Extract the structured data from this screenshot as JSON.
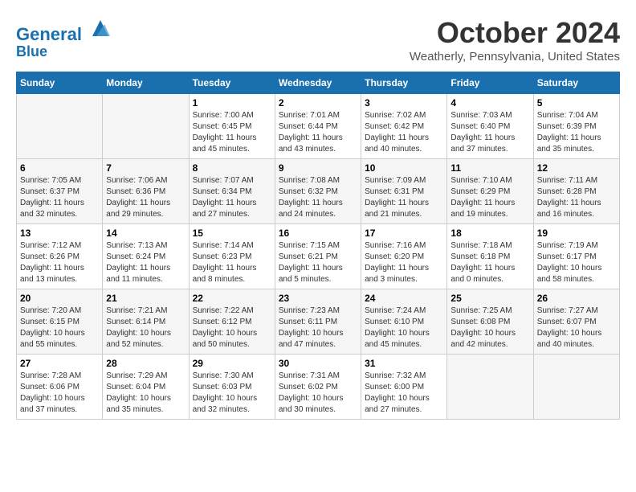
{
  "header": {
    "logo_line1": "General",
    "logo_line2": "Blue",
    "month_title": "October 2024",
    "location": "Weatherly, Pennsylvania, United States"
  },
  "weekdays": [
    "Sunday",
    "Monday",
    "Tuesday",
    "Wednesday",
    "Thursday",
    "Friday",
    "Saturday"
  ],
  "weeks": [
    [
      {
        "day": null
      },
      {
        "day": null
      },
      {
        "day": "1",
        "sunrise": "Sunrise: 7:00 AM",
        "sunset": "Sunset: 6:45 PM",
        "daylight": "Daylight: 11 hours and 45 minutes."
      },
      {
        "day": "2",
        "sunrise": "Sunrise: 7:01 AM",
        "sunset": "Sunset: 6:44 PM",
        "daylight": "Daylight: 11 hours and 43 minutes."
      },
      {
        "day": "3",
        "sunrise": "Sunrise: 7:02 AM",
        "sunset": "Sunset: 6:42 PM",
        "daylight": "Daylight: 11 hours and 40 minutes."
      },
      {
        "day": "4",
        "sunrise": "Sunrise: 7:03 AM",
        "sunset": "Sunset: 6:40 PM",
        "daylight": "Daylight: 11 hours and 37 minutes."
      },
      {
        "day": "5",
        "sunrise": "Sunrise: 7:04 AM",
        "sunset": "Sunset: 6:39 PM",
        "daylight": "Daylight: 11 hours and 35 minutes."
      }
    ],
    [
      {
        "day": "6",
        "sunrise": "Sunrise: 7:05 AM",
        "sunset": "Sunset: 6:37 PM",
        "daylight": "Daylight: 11 hours and 32 minutes."
      },
      {
        "day": "7",
        "sunrise": "Sunrise: 7:06 AM",
        "sunset": "Sunset: 6:36 PM",
        "daylight": "Daylight: 11 hours and 29 minutes."
      },
      {
        "day": "8",
        "sunrise": "Sunrise: 7:07 AM",
        "sunset": "Sunset: 6:34 PM",
        "daylight": "Daylight: 11 hours and 27 minutes."
      },
      {
        "day": "9",
        "sunrise": "Sunrise: 7:08 AM",
        "sunset": "Sunset: 6:32 PM",
        "daylight": "Daylight: 11 hours and 24 minutes."
      },
      {
        "day": "10",
        "sunrise": "Sunrise: 7:09 AM",
        "sunset": "Sunset: 6:31 PM",
        "daylight": "Daylight: 11 hours and 21 minutes."
      },
      {
        "day": "11",
        "sunrise": "Sunrise: 7:10 AM",
        "sunset": "Sunset: 6:29 PM",
        "daylight": "Daylight: 11 hours and 19 minutes."
      },
      {
        "day": "12",
        "sunrise": "Sunrise: 7:11 AM",
        "sunset": "Sunset: 6:28 PM",
        "daylight": "Daylight: 11 hours and 16 minutes."
      }
    ],
    [
      {
        "day": "13",
        "sunrise": "Sunrise: 7:12 AM",
        "sunset": "Sunset: 6:26 PM",
        "daylight": "Daylight: 11 hours and 13 minutes."
      },
      {
        "day": "14",
        "sunrise": "Sunrise: 7:13 AM",
        "sunset": "Sunset: 6:24 PM",
        "daylight": "Daylight: 11 hours and 11 minutes."
      },
      {
        "day": "15",
        "sunrise": "Sunrise: 7:14 AM",
        "sunset": "Sunset: 6:23 PM",
        "daylight": "Daylight: 11 hours and 8 minutes."
      },
      {
        "day": "16",
        "sunrise": "Sunrise: 7:15 AM",
        "sunset": "Sunset: 6:21 PM",
        "daylight": "Daylight: 11 hours and 5 minutes."
      },
      {
        "day": "17",
        "sunrise": "Sunrise: 7:16 AM",
        "sunset": "Sunset: 6:20 PM",
        "daylight": "Daylight: 11 hours and 3 minutes."
      },
      {
        "day": "18",
        "sunrise": "Sunrise: 7:18 AM",
        "sunset": "Sunset: 6:18 PM",
        "daylight": "Daylight: 11 hours and 0 minutes."
      },
      {
        "day": "19",
        "sunrise": "Sunrise: 7:19 AM",
        "sunset": "Sunset: 6:17 PM",
        "daylight": "Daylight: 10 hours and 58 minutes."
      }
    ],
    [
      {
        "day": "20",
        "sunrise": "Sunrise: 7:20 AM",
        "sunset": "Sunset: 6:15 PM",
        "daylight": "Daylight: 10 hours and 55 minutes."
      },
      {
        "day": "21",
        "sunrise": "Sunrise: 7:21 AM",
        "sunset": "Sunset: 6:14 PM",
        "daylight": "Daylight: 10 hours and 52 minutes."
      },
      {
        "day": "22",
        "sunrise": "Sunrise: 7:22 AM",
        "sunset": "Sunset: 6:12 PM",
        "daylight": "Daylight: 10 hours and 50 minutes."
      },
      {
        "day": "23",
        "sunrise": "Sunrise: 7:23 AM",
        "sunset": "Sunset: 6:11 PM",
        "daylight": "Daylight: 10 hours and 47 minutes."
      },
      {
        "day": "24",
        "sunrise": "Sunrise: 7:24 AM",
        "sunset": "Sunset: 6:10 PM",
        "daylight": "Daylight: 10 hours and 45 minutes."
      },
      {
        "day": "25",
        "sunrise": "Sunrise: 7:25 AM",
        "sunset": "Sunset: 6:08 PM",
        "daylight": "Daylight: 10 hours and 42 minutes."
      },
      {
        "day": "26",
        "sunrise": "Sunrise: 7:27 AM",
        "sunset": "Sunset: 6:07 PM",
        "daylight": "Daylight: 10 hours and 40 minutes."
      }
    ],
    [
      {
        "day": "27",
        "sunrise": "Sunrise: 7:28 AM",
        "sunset": "Sunset: 6:06 PM",
        "daylight": "Daylight: 10 hours and 37 minutes."
      },
      {
        "day": "28",
        "sunrise": "Sunrise: 7:29 AM",
        "sunset": "Sunset: 6:04 PM",
        "daylight": "Daylight: 10 hours and 35 minutes."
      },
      {
        "day": "29",
        "sunrise": "Sunrise: 7:30 AM",
        "sunset": "Sunset: 6:03 PM",
        "daylight": "Daylight: 10 hours and 32 minutes."
      },
      {
        "day": "30",
        "sunrise": "Sunrise: 7:31 AM",
        "sunset": "Sunset: 6:02 PM",
        "daylight": "Daylight: 10 hours and 30 minutes."
      },
      {
        "day": "31",
        "sunrise": "Sunrise: 7:32 AM",
        "sunset": "Sunset: 6:00 PM",
        "daylight": "Daylight: 10 hours and 27 minutes."
      },
      {
        "day": null
      },
      {
        "day": null
      }
    ]
  ]
}
